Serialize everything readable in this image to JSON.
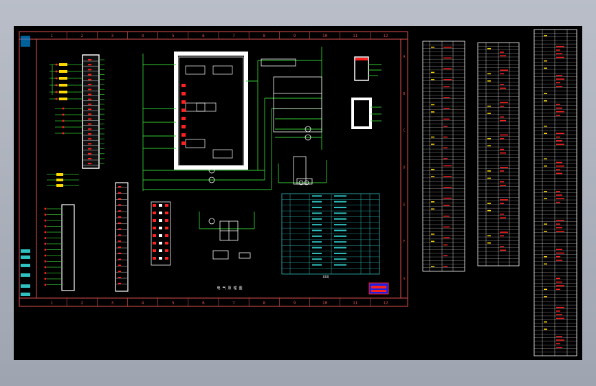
{
  "drawing": {
    "border_color": "#e05050",
    "wire_color": "#33cc33",
    "line_color": "#ffffff",
    "mark_color": "#ff2020",
    "table_color": "#30c0c0",
    "accent_yellow": "#ffd800",
    "grid_columns": [
      "1",
      "2",
      "3",
      "4",
      "5",
      "6",
      "7",
      "8",
      "9",
      "10",
      "11",
      "12"
    ],
    "grid_rows": [
      "A",
      "B",
      "C",
      "D",
      "E",
      "F",
      "G"
    ],
    "center_caption": "电 气 原 理 图",
    "title_block_mark": "XXX"
  },
  "tables": {
    "sheet_count": 3
  }
}
